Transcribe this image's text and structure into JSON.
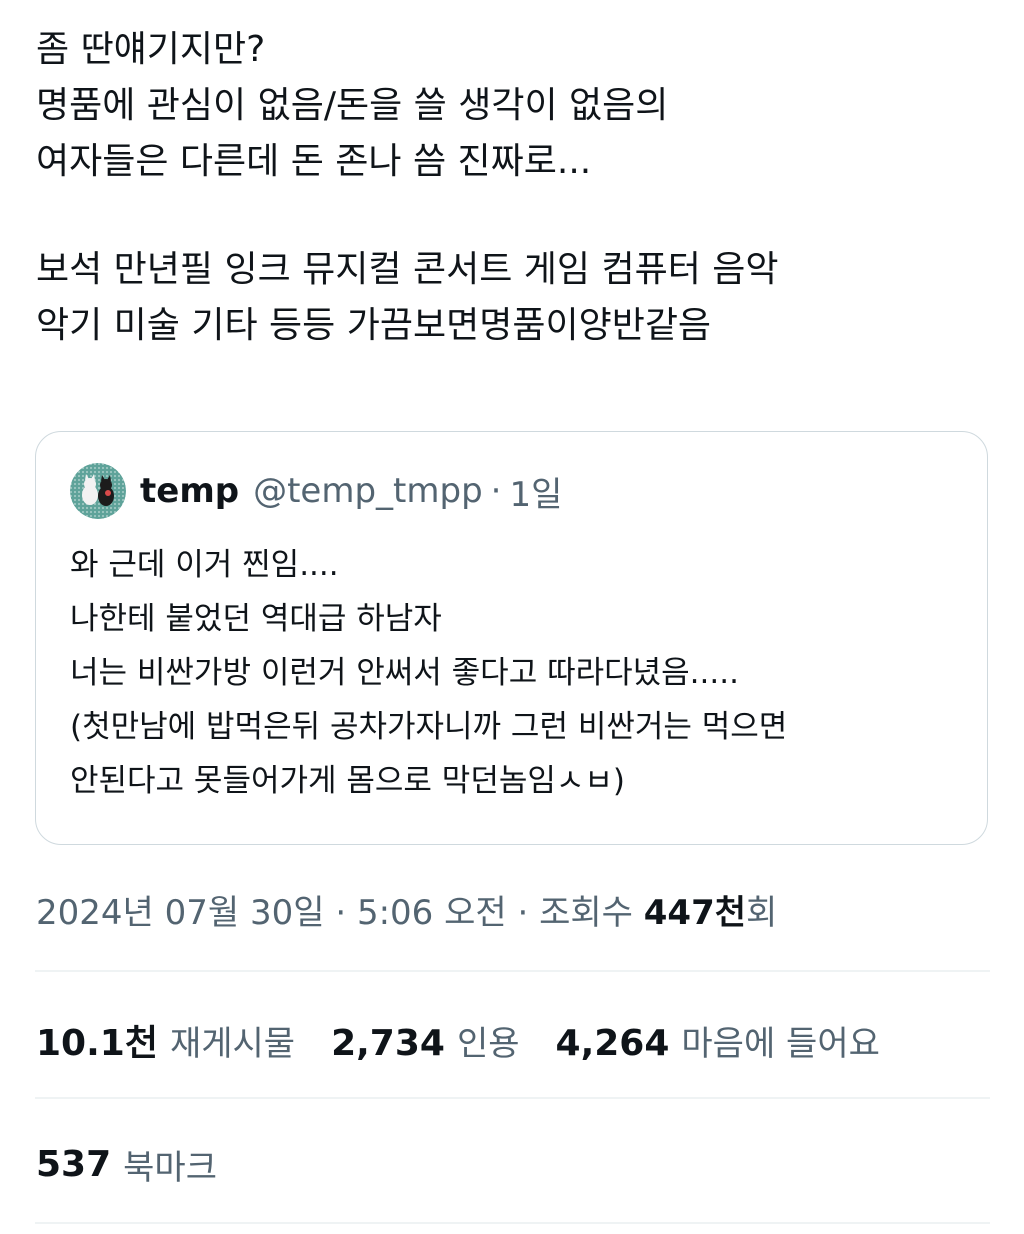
{
  "tweet": {
    "lines": [
      "좀 딴얘기지만?",
      "명품에 관심이 없음/돈을 쓸 생각이 없음의",
      "여자들은 다른데 돈 존나 씀 진짜로...",
      "",
      "보석 만년필 잉크 뮤지컬 콘서트 게임 컴퓨터 음악",
      "악기 미술 기타 등등 가끔보면명품이양반같음"
    ]
  },
  "quote": {
    "name": "temp",
    "handle": "@temp_tmpp",
    "separator": "·",
    "time": "1일",
    "lines": [
      "와 근데 이거 찐임....",
      "나한테 붙었던 역대급 하남자",
      "너는 비싼가방 이런거 안써서 좋다고 따라다녔음.....",
      "(첫만남에 밥먹은뒤 공차가자니까 그런 비싼거는 먹으면",
      "안된다고 못들어가게 몸으로 막던놈임ㅅㅂ)"
    ]
  },
  "meta": {
    "date": "2024년 07월 30일",
    "separator1": " · ",
    "time": "5:06 오전",
    "separator2": " · ",
    "views_label": "조회수 ",
    "views_count": "447천",
    "views_suffix": "회"
  },
  "stats": {
    "reposts_count": "10.1천",
    "reposts_label": "재게시물",
    "quotes_count": "2,734",
    "quotes_label": "인용",
    "likes_count": "4,264",
    "likes_label": "마음에 들어요"
  },
  "bookmarks": {
    "count": "537",
    "label": "북마크"
  },
  "colors": {
    "text_primary": "#0f1419",
    "text_secondary": "#536471",
    "border": "#cfd9de",
    "divider": "#eff3f4"
  }
}
